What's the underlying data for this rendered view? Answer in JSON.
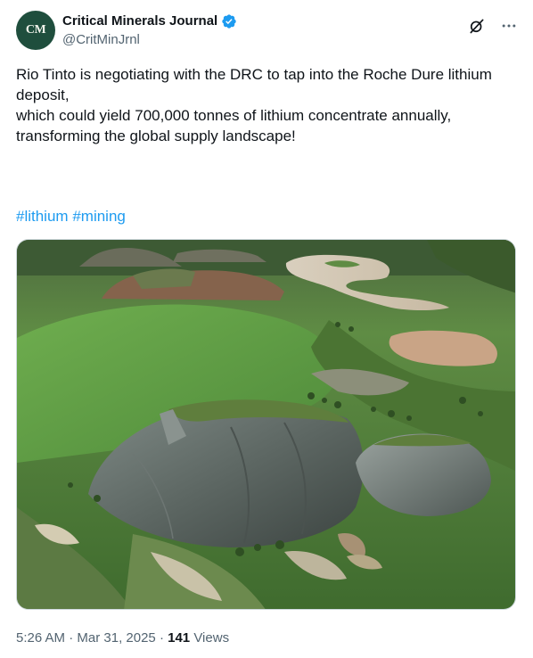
{
  "author": {
    "avatar_text": "CM",
    "display_name": "Critical Minerals Journal",
    "handle": "@CritMinJrnl"
  },
  "tweet": {
    "lines": [
      "Rio Tinto is negotiating with the DRC to tap into the Roche Dure lithium deposit,",
      "which could yield 700,000 tonnes of lithium concentrate annually,",
      "transforming the global supply landscape!"
    ],
    "hashtags": [
      "#lithium",
      "#mining"
    ]
  },
  "meta": {
    "time": "5:26 AM",
    "separator": "·",
    "date": "Mar 31, 2025",
    "views_count": "141",
    "views_label": "Views"
  },
  "colors": {
    "link": "#1d9bf0",
    "verified": "#1d9bf0",
    "muted": "#536471",
    "avatar_bg": "#1f4e3d"
  },
  "icons": {
    "verified": "verified-badge-icon",
    "grok": "grok-icon",
    "more": "more-icon"
  }
}
